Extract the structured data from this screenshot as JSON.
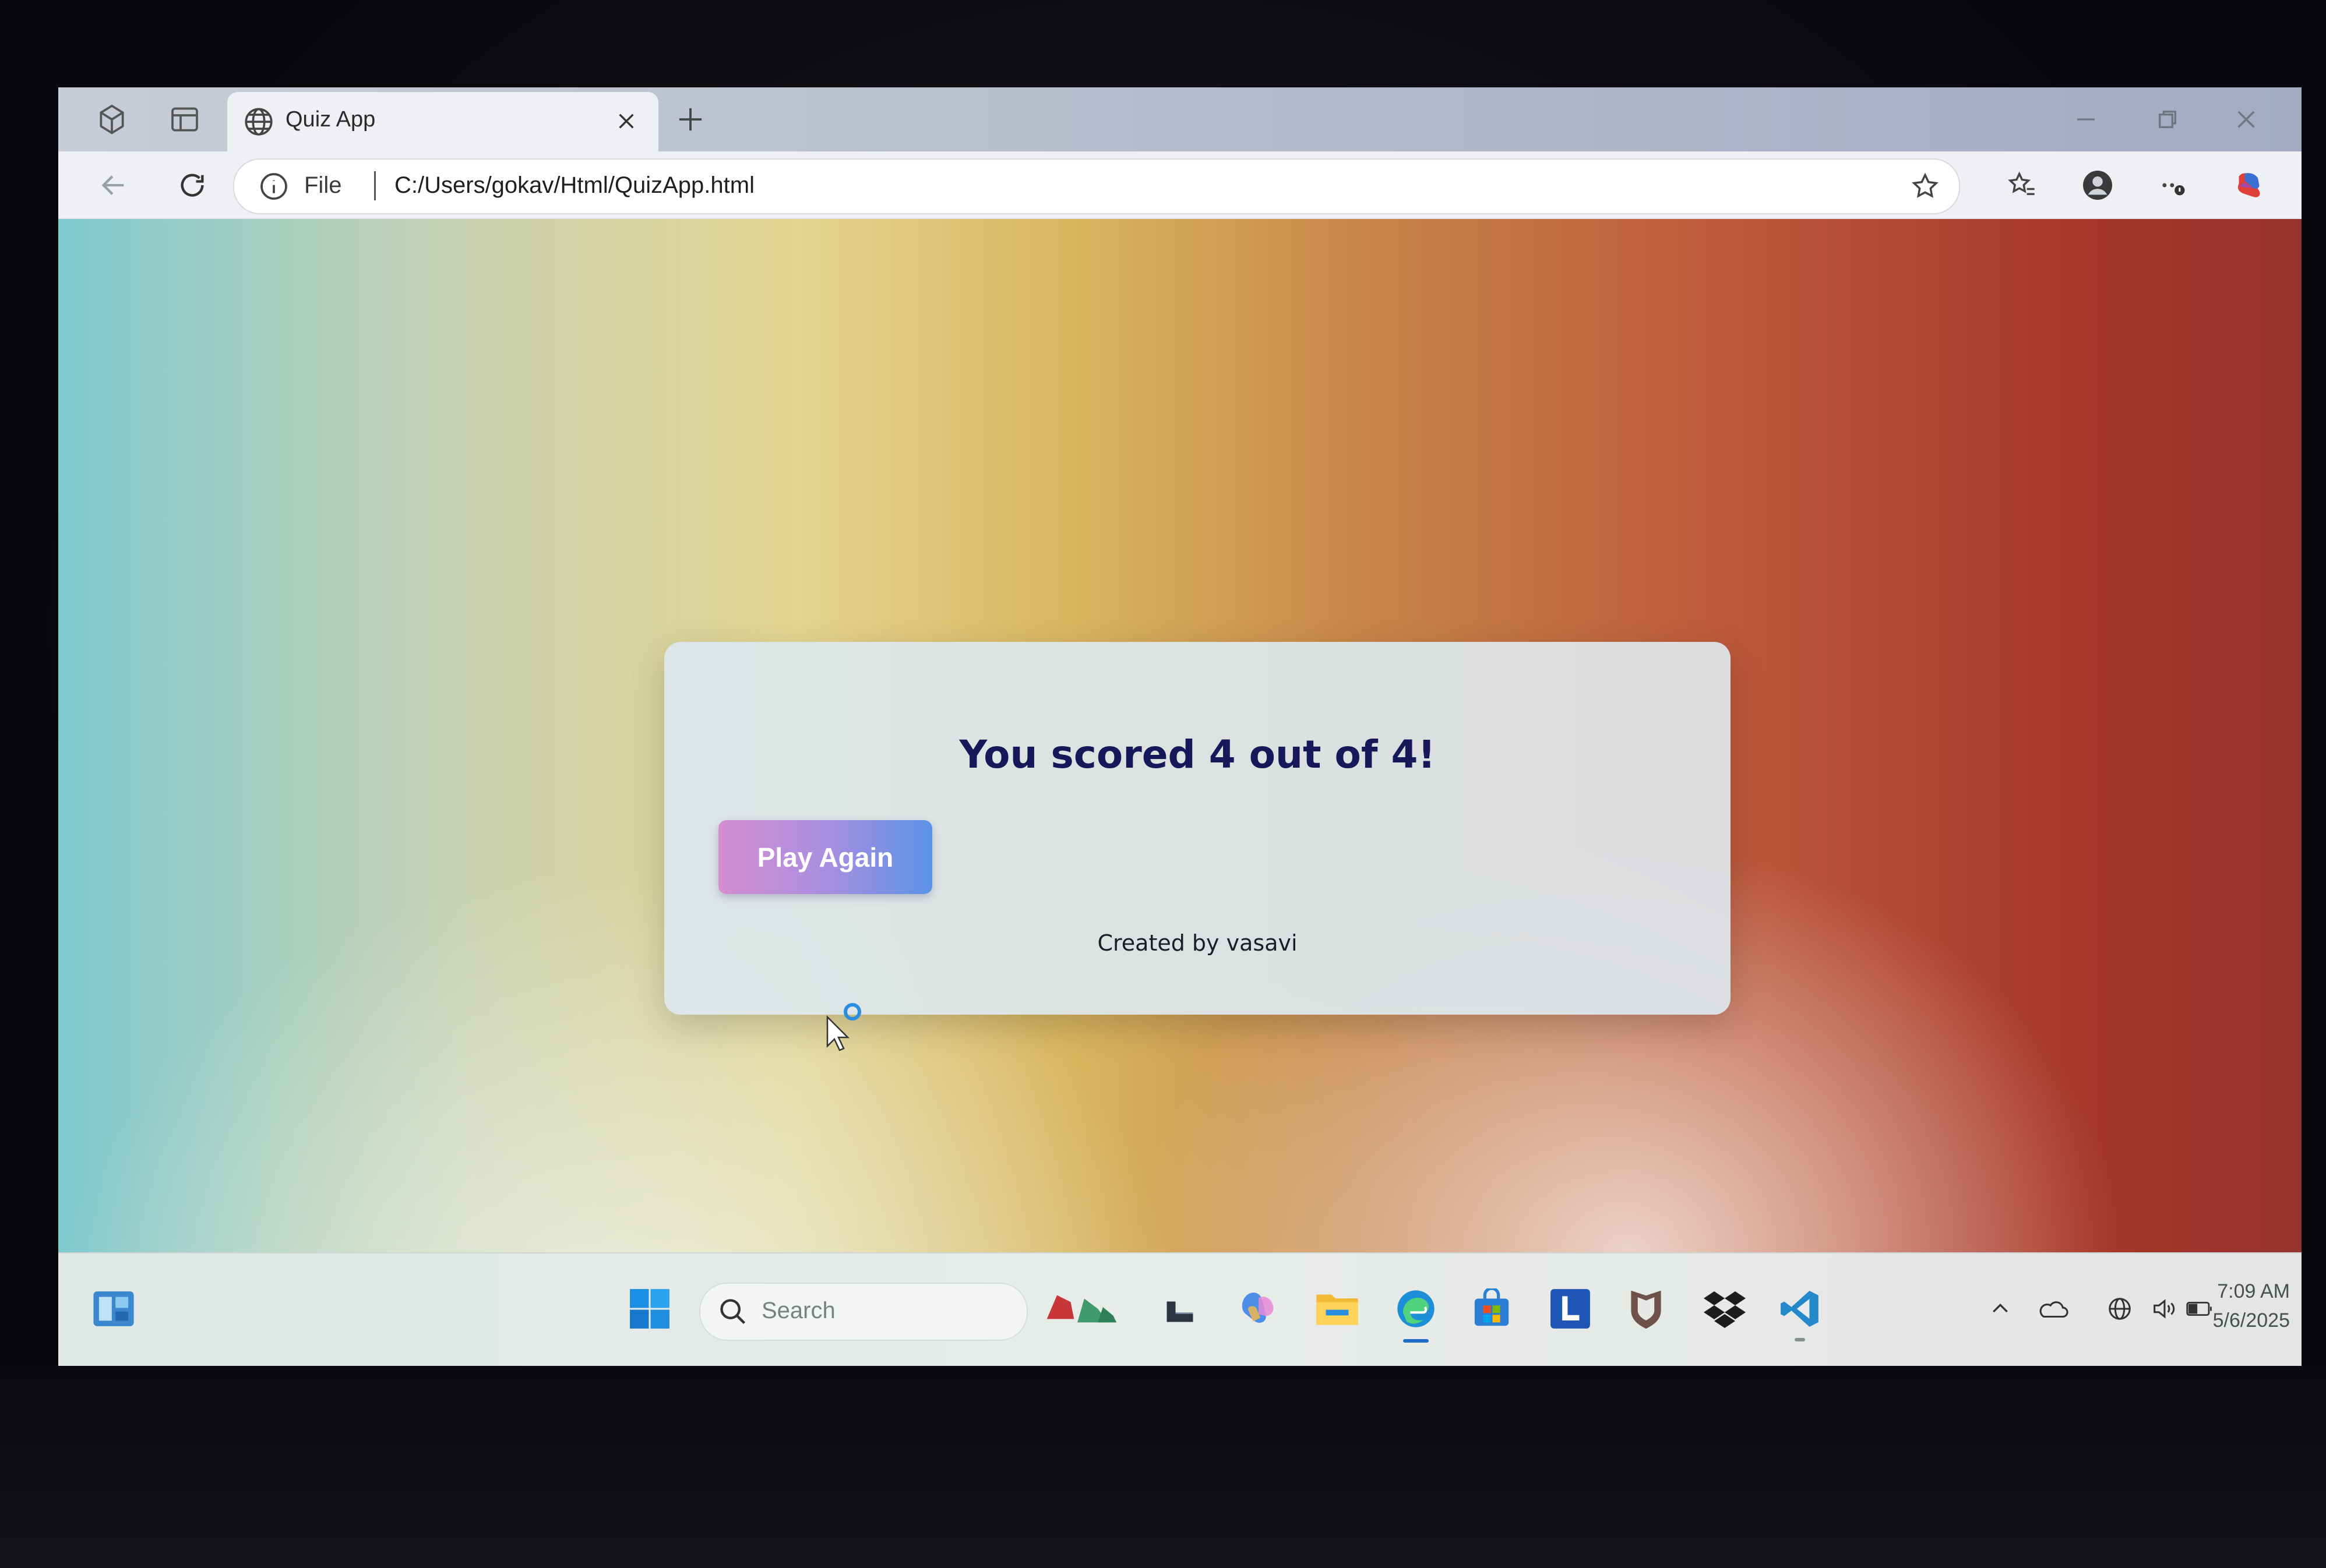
{
  "browser": {
    "tab_title": "Quiz App",
    "address_scheme": "File",
    "address_url": "C:/Users/gokav/Html/QuizApp.html"
  },
  "page": {
    "score_text": "You scored 4 out of 4!",
    "play_again_label": "Play Again",
    "credit_text": "Created by vasavi"
  },
  "taskbar": {
    "search_placeholder": "Search",
    "time": "7:09 AM",
    "date": "5/6/2025"
  },
  "colors": {
    "score_text": "#16185a",
    "button_gradient_start": "#d58dd0",
    "button_gradient_end": "#5b93e6"
  }
}
